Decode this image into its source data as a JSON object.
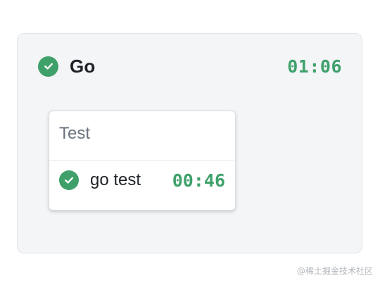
{
  "pipeline": {
    "title": "Go",
    "status_icon": "check-circle-icon",
    "duration": "01:06"
  },
  "stage": {
    "name": "Test",
    "jobs": [
      {
        "name": "go test",
        "status_icon": "check-circle-icon",
        "duration": "00:46"
      }
    ]
  },
  "watermark": "@稀土掘金技术社区",
  "colors": {
    "success": "#3fa06a",
    "panel_background": "#f3f5f7",
    "card_background": "#ffffff"
  }
}
